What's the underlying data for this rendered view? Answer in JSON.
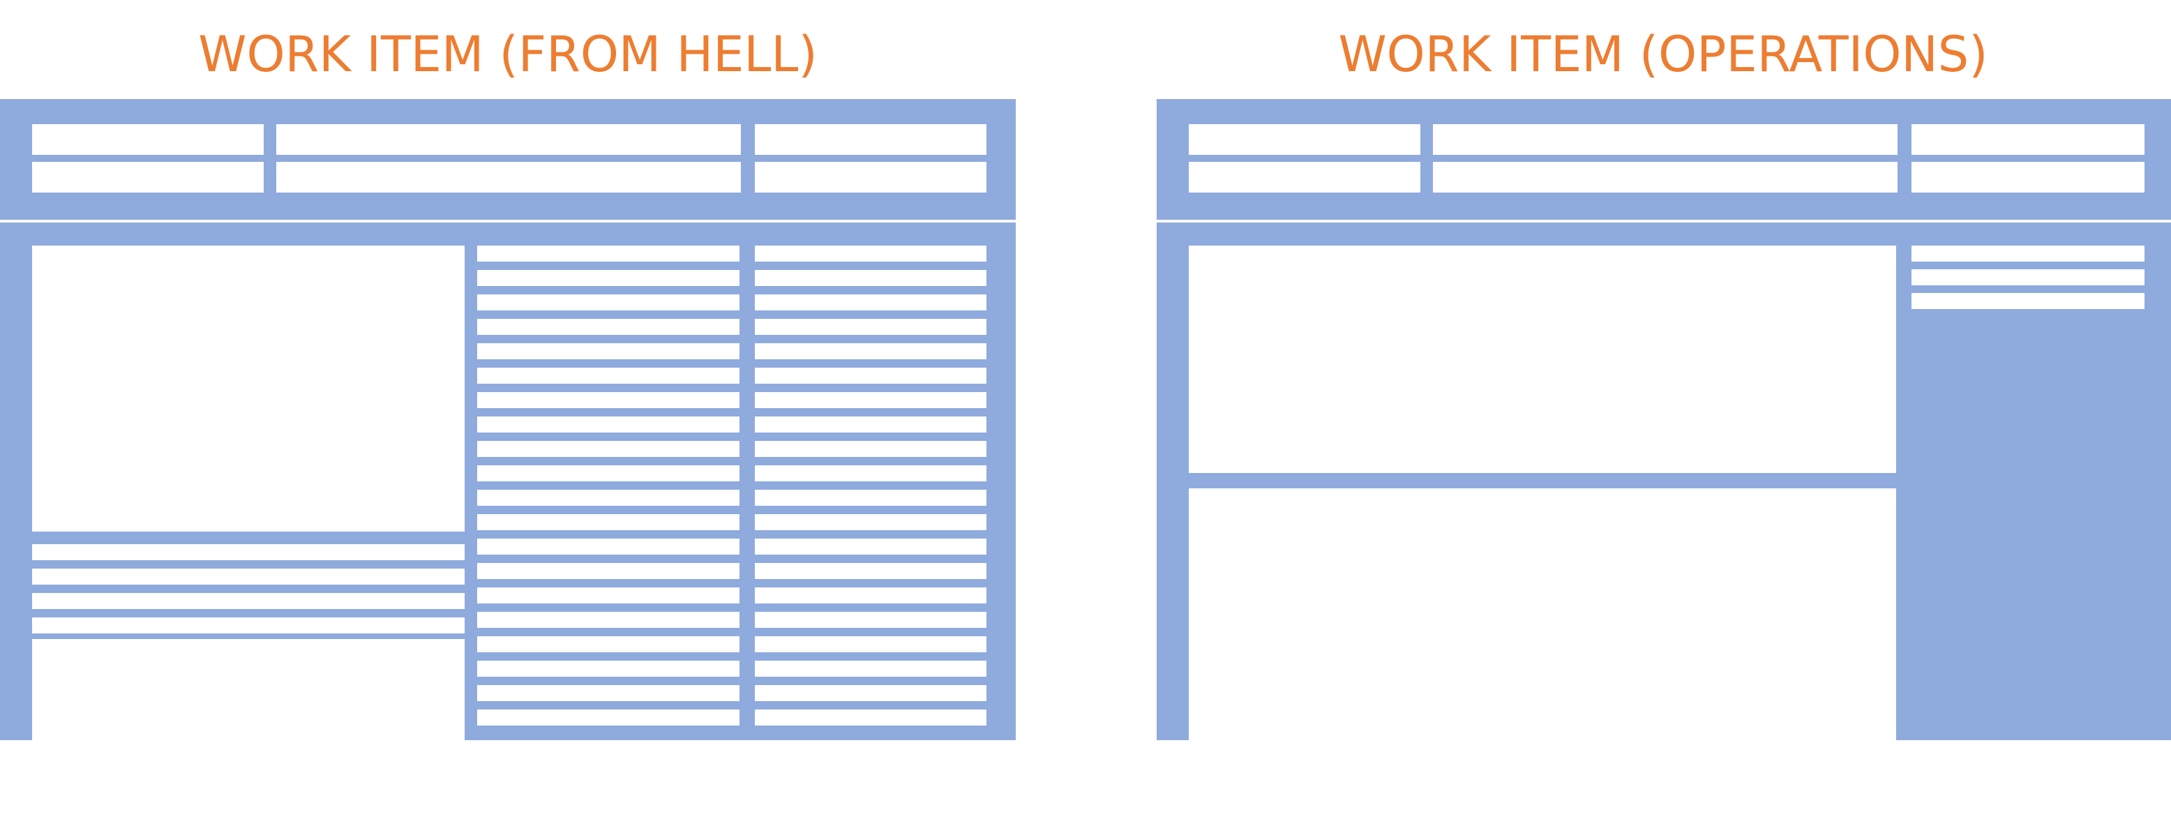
{
  "colors": {
    "title": "#ED7D31",
    "panel": "#8FAADC",
    "field": "#FFFFFF"
  },
  "left": {
    "title": "WORK ITEM (FROM HELL)"
  },
  "right": {
    "title": "WORK ITEM (OPERATIONS)"
  }
}
